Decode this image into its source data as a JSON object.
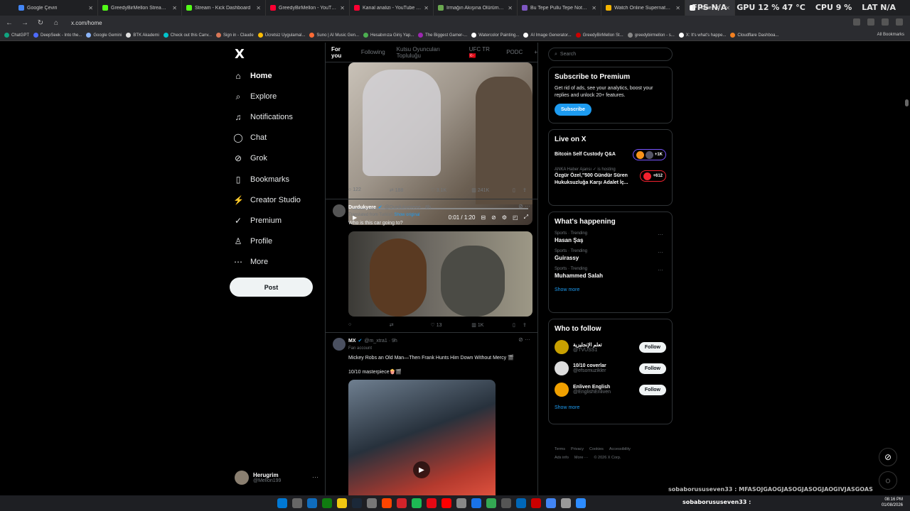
{
  "browser": {
    "tabs": [
      {
        "title": "Google Çeviri",
        "color": "#4285f4"
      },
      {
        "title": "GreedyBirMellon Stream - Wat",
        "color": "#53fc18"
      },
      {
        "title": "Stream - Kick Dashboard",
        "color": "#53fc18"
      },
      {
        "title": "GreedyBirMellon - YouTube",
        "color": "#ff0033"
      },
      {
        "title": "Kanal analizi - YouTube Studio",
        "color": "#ff0033"
      },
      {
        "title": "Irmağın Akışına Ölürüm Türk",
        "color": "#6aa84f"
      },
      {
        "title": "Bu Tepe Pullu Tepe Notaları | N",
        "color": "#7e57c2"
      },
      {
        "title": "Watch Online Supernatural Se",
        "color": "#f4b400"
      },
      {
        "title": "Home / X",
        "color": "#ffffff"
      }
    ],
    "url": "x.com/home",
    "perf": {
      "fps": "FPS  N/A",
      "gpu": "GPU  12 %  47 °C",
      "cpu": "CPU  9 %",
      "lat": "LAT  N/A"
    },
    "bookmarks": [
      "ChatGPT",
      "DeepSeek - Into the...",
      "Google Gemini",
      "BTK Akademi",
      "Check out this Canv...",
      "Sign in - Claude",
      "Ücretsiz Uygulamal...",
      "Suno | AI Music Gen...",
      "Hesabınıza Giriş Yap...",
      "The Biggest Gamer-...",
      "Watercolor Painting...",
      "AI Image Generator...",
      "GreedyBirMellon St...",
      "greedybirmellon - s...",
      "X: It's what's happe...",
      "Cloudflare Dashboa..."
    ],
    "all_bookmarks": "All Bookmarks"
  },
  "nav": {
    "logo": "X",
    "items": [
      {
        "label": "Home",
        "icon": "⌂"
      },
      {
        "label": "Explore",
        "icon": "⌕"
      },
      {
        "label": "Notifications",
        "icon": "♫"
      },
      {
        "label": "Chat",
        "icon": "◯"
      },
      {
        "label": "Grok",
        "icon": "⊘"
      },
      {
        "label": "Bookmarks",
        "icon": "▯"
      },
      {
        "label": "Creator Studio",
        "icon": "⚡"
      },
      {
        "label": "Premium",
        "icon": "✓"
      },
      {
        "label": "Profile",
        "icon": "♙"
      },
      {
        "label": "More",
        "icon": "⋯"
      }
    ],
    "post": "Post",
    "account": {
      "name": "Herugrim",
      "handle": "@Mellon199",
      "more": "···"
    }
  },
  "feed": {
    "tabs": [
      "For you",
      "Following",
      "Kutsu Oyuncuları Topluluğu",
      "UFC TR 🇹🇷",
      "PODC",
      "+"
    ],
    "tweet1": {
      "time": "0:01 / 1:20",
      "replies": "122",
      "reposts": "188",
      "likes": "3.1K",
      "views": "241K"
    },
    "tweet2": {
      "name": "Durdukyere",
      "handle": "@Durdukyereee · 8h",
      "translated": "Translated from Turkish",
      "show_original": "Show original",
      "text": "Who is this car going to?",
      "replies": "",
      "reposts": "",
      "likes": "13",
      "views": "1K"
    },
    "tweet3": {
      "name": "MX",
      "handle": "@m_xtra1 · 9h",
      "badge": "Fan account",
      "text": "Mickey Robs an Old Man—Then Frank Hunts Him Down Without Mercy 🎬",
      "text2": "10/10 masterpiece🍿🎬"
    }
  },
  "right": {
    "search_placeholder": "Search",
    "premium": {
      "title": "Subscribe to Premium",
      "body": "Get rid of ads, see your analytics, boost your replies and unlock 20+ features.",
      "button": "Subscribe"
    },
    "live": {
      "title": "Live on X",
      "items": [
        {
          "title": "Bitcoin Self Custody Q&A",
          "host": "",
          "count": "+1K"
        },
        {
          "title": "ANKA Haber Ajansı ✓ is hosting",
          "title2": "Özgür Özel,\"500 Gündür Süren Hukuksuzluğa Karşı Adalet İç...",
          "count": "+612"
        }
      ]
    },
    "happening": {
      "title": "What's happening",
      "trends": [
        {
          "cat": "Sports · Trending",
          "name": "Hasan Şaş"
        },
        {
          "cat": "Sports · Trending",
          "name": "Guirassy"
        },
        {
          "cat": "Sports · Trending",
          "name": "Muhammed Salah"
        }
      ],
      "show_more": "Show more"
    },
    "who": {
      "title": "Who to follow",
      "people": [
        {
          "name": "تعلم الإنجليزية",
          "handle": "@TVUSS1",
          "color": "#c8a000"
        },
        {
          "name": "10/10 coverlar",
          "handle": "@efsomuzikler",
          "color": "#ddd"
        },
        {
          "name": "Enliven English",
          "handle": "@EnglishEnliven",
          "color": "#f0a000"
        }
      ],
      "follow": "Follow",
      "show_more": "Show more"
    },
    "footer": [
      "Terms",
      "Privacy",
      "Cookies",
      "Accessibility",
      "Ads info",
      "More ···",
      "© 2026 X Corp."
    ]
  },
  "overlay": {
    "chat_line1": "sobaborususeven33 : MFASOJGAOGJASOGJASOGJAOGIVJASGOAS",
    "chat_line2": "sobaborususeven33 :"
  },
  "taskbar": {
    "time": "08:16 PM",
    "date": "01/08/2026"
  }
}
